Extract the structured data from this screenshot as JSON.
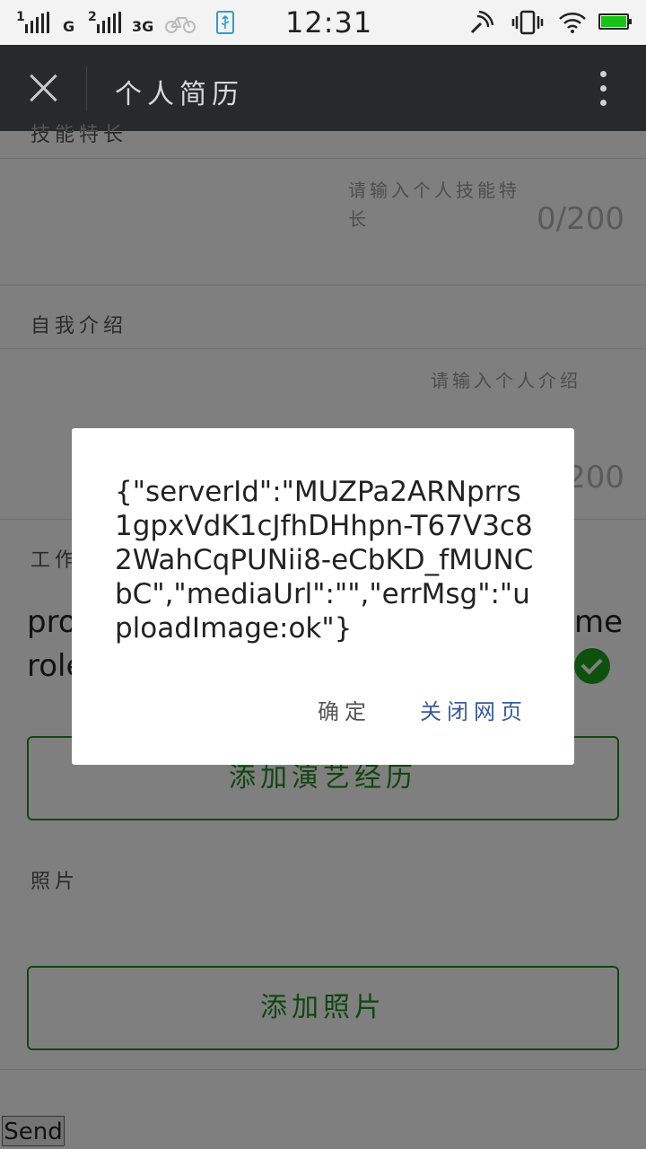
{
  "status_bar": {
    "sim1_label": "1",
    "sim1_net": "G",
    "sim2_label": "2",
    "sim2_net": "3G",
    "time": "12:31"
  },
  "titlebar": {
    "title": "个人简历"
  },
  "form": {
    "skills": {
      "label": "技能特长",
      "placeholder": "请输入个人技能特长",
      "counter": "0/200"
    },
    "intro": {
      "label": "自我介绍",
      "placeholder": "请输入个人介绍",
      "counter": "0/200"
    },
    "work": {
      "label": "工作",
      "text_line1_start": "pro",
      "text_line1_end": "me",
      "text_line2_start": "role"
    },
    "add_experience_button": "添加演艺经历",
    "photos": {
      "label": "照片",
      "add_button": "添加照片"
    },
    "send_button": "Send"
  },
  "dialog": {
    "message": "{\"serverId\":\"MUZPa2ARNprrs1gpxVdK1cJfhDHhpn-T67V3c82WahCqPUNii8-eCbKD_fMUNCbC\",\"mediaUrl\":\"\",\"errMsg\":\"uploadImage:ok\"}",
    "ok_label": "确定",
    "close_page_label": "关闭网页"
  },
  "colors": {
    "accent_green": "#1e8f1e",
    "titlebar_bg": "#27292b",
    "link_blue": "#3a5a9b"
  }
}
